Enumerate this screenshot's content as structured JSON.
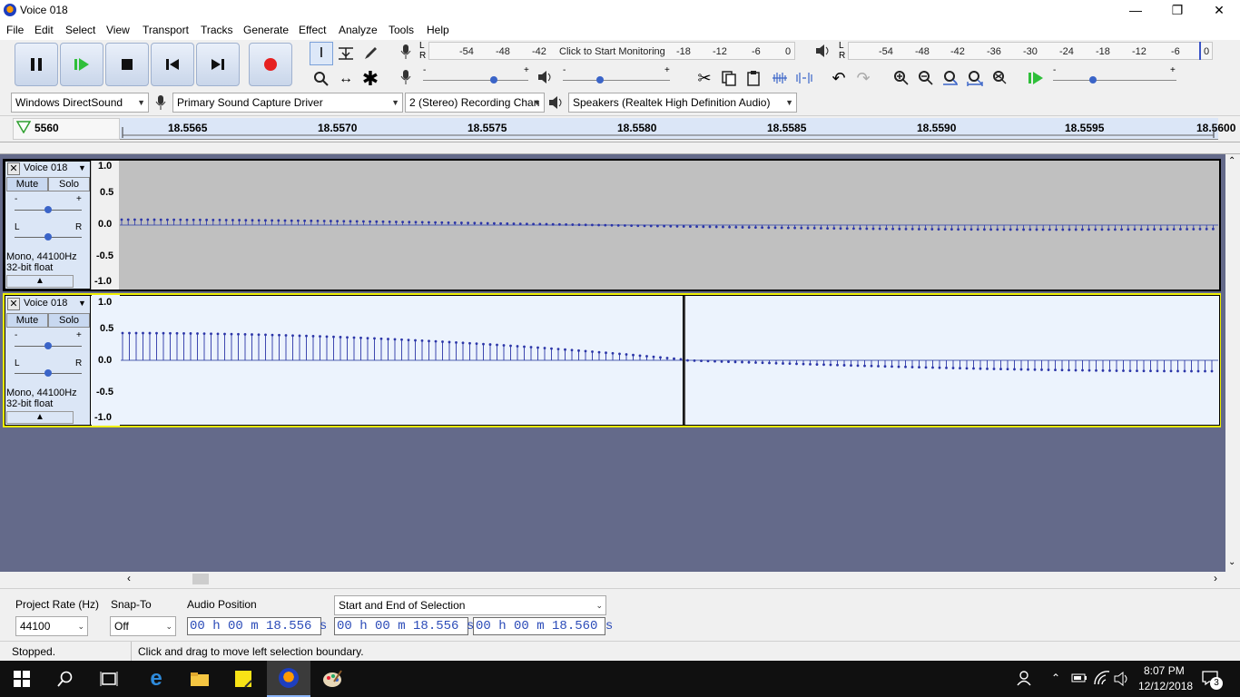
{
  "window": {
    "title": "Voice 018",
    "minimize": "—",
    "restore": "❐",
    "close": "✕"
  },
  "menu": [
    "File",
    "Edit",
    "Select",
    "View",
    "Transport",
    "Tracks",
    "Generate",
    "Effect",
    "Analyze",
    "Tools",
    "Help"
  ],
  "meters": {
    "rec_scale": [
      "-54",
      "-48",
      "-42",
      "-18",
      "-12",
      "-6",
      "0"
    ],
    "rec_prompt": "Click to Start Monitoring",
    "play_scale": [
      "-54",
      "-48",
      "-42",
      "-36",
      "-30",
      "-24",
      "-18",
      "-12",
      "-6",
      "0"
    ],
    "lr": [
      "L",
      "R"
    ]
  },
  "device": {
    "host": "Windows DirectSound",
    "rec_device": "Primary Sound Capture Driver",
    "channels": "2 (Stereo) Recording Chan",
    "play_device": "Speakers (Realtek High Definition Audio)"
  },
  "slider_marks": {
    "minus": "-",
    "plus": "+"
  },
  "ruler": {
    "labels": [
      "5560",
      "18.5565",
      "18.5570",
      "18.5575",
      "18.5580",
      "18.5585",
      "18.5590",
      "18.5595",
      "18.5600"
    ]
  },
  "tracks": [
    {
      "name": "Voice 018",
      "close": "✕",
      "dropdown": "▼",
      "mute": "Mute",
      "solo": "Solo",
      "gain_minus": "-",
      "gain_plus": "+",
      "pan_l": "L",
      "pan_r": "R",
      "info1": "Mono, 44100Hz",
      "info2": "32-bit float",
      "collapse": "▲",
      "scale": [
        "1.0",
        "0.5",
        "0.0",
        "-0.5",
        "-1.0"
      ],
      "selected": false
    },
    {
      "name": "Voice 018",
      "close": "✕",
      "dropdown": "▼",
      "mute": "Mute",
      "solo": "Solo",
      "gain_minus": "-",
      "gain_plus": "+",
      "pan_l": "L",
      "pan_r": "R",
      "info1": "Mono, 44100Hz",
      "info2": "32-bit float",
      "collapse": "▲",
      "scale": [
        "1.0",
        "0.5",
        "0.0",
        "-0.5",
        "-1.0"
      ],
      "selected": true
    }
  ],
  "selection_toolbar": {
    "project_rate_label": "Project Rate (Hz)",
    "project_rate": "44100",
    "snap_to_label": "Snap-To",
    "snap_to": "Off",
    "audio_position_label": "Audio Position",
    "audio_position": "00 h 00 m 18.556 s",
    "selection_mode": "Start and End of Selection",
    "start": "00 h 00 m 18.556 s",
    "end": "00 h 00 m 18.560 s"
  },
  "status": {
    "state": "Stopped.",
    "hint": "Click and drag to move left selection boundary."
  },
  "taskbar": {
    "time": "8:07 PM",
    "date": "12/12/2018",
    "notif_count": "3"
  },
  "colors": {
    "waveform": "#2b35a8",
    "track_bg": "#c0c0c0",
    "selected_track_bg": "#ecf3fd",
    "trackarea_bg": "#646a8a",
    "record": "#e62020",
    "play": "#2fbf3a"
  }
}
